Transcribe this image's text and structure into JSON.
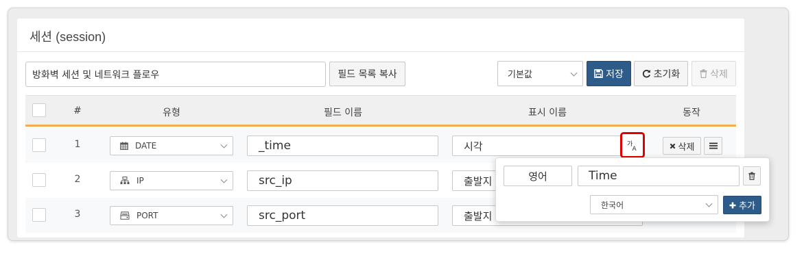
{
  "panel": {
    "title": "세션 (session)"
  },
  "toolbar": {
    "name_value": "방화벽 세션 및 네트워크 플로우",
    "copy_label": "필드 목록 복사",
    "preset_value": "기본값",
    "save_label": "저장",
    "reset_label": "초기화",
    "delete_label": "삭제"
  },
  "table": {
    "headers": {
      "num": "#",
      "type": "유형",
      "field": "필드 이름",
      "display": "표시 이름",
      "action": "동작"
    },
    "rows": [
      {
        "num": "1",
        "type": "DATE",
        "type_icon": "calendar-icon",
        "field": "_time",
        "display": "시각",
        "delete_label": "삭제"
      },
      {
        "num": "2",
        "type": "IP",
        "type_icon": "network-icon",
        "field": "src_ip",
        "display": "출발지"
      },
      {
        "num": "3",
        "type": "PORT",
        "type_icon": "hdd-icon",
        "field": "src_port",
        "display": "출발지"
      }
    ]
  },
  "translate_popover": {
    "language": "영어",
    "value": "Time",
    "new_language": "한국어",
    "add_label": "추가"
  },
  "colors": {
    "primary": "#2e5c8a",
    "header_underline": "#f0ad4e",
    "highlight": "#e00000"
  }
}
